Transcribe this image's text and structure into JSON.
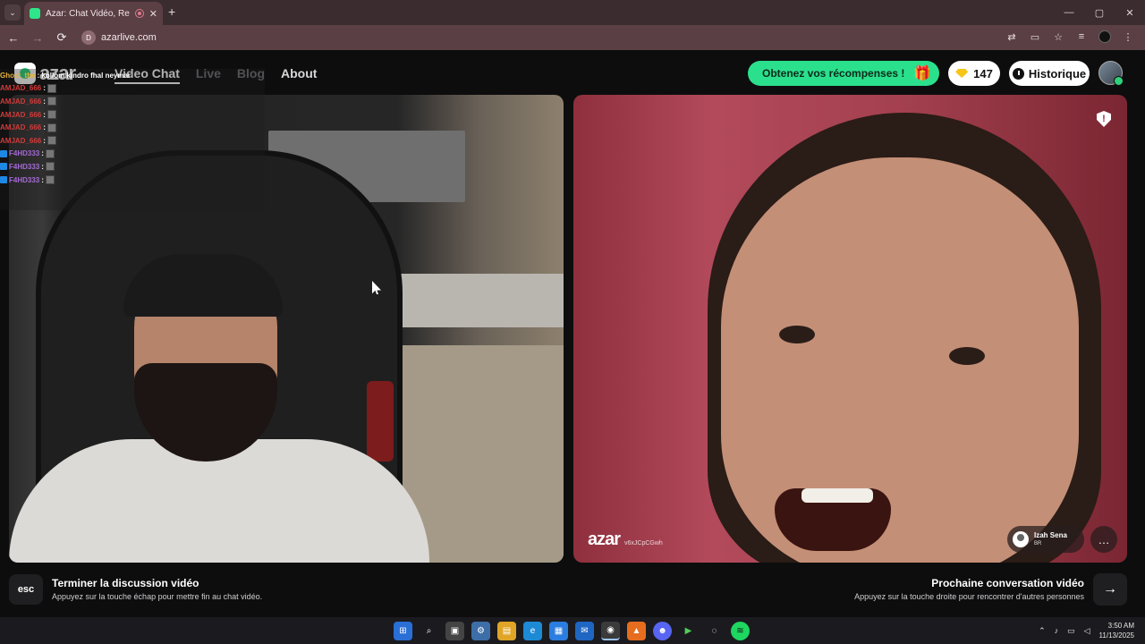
{
  "browser": {
    "tab_title": "Azar: Chat Vidéo, Rencontr",
    "new_tab": "+",
    "url": "azarlive.com",
    "window_controls": [
      "—",
      "▢",
      "✕"
    ]
  },
  "header": {
    "logo": "azar",
    "nav": [
      "Video Chat",
      "Live",
      "Blog",
      "About"
    ],
    "reward_label": "Obtenez vos récompenses !",
    "gems": "147",
    "history_label": "Historique"
  },
  "overlay_chat": {
    "first": {
      "user": "Ghost_the",
      "msg": ": kollom kindro fhal neymar"
    },
    "rows": [
      {
        "user": "AMJAD_666",
        "color": "#d23a3a"
      },
      {
        "user": "AMJAD_666",
        "color": "#d23a3a"
      },
      {
        "user": "AMJAD_666",
        "color": "#d23a3a"
      },
      {
        "user": "AMJAD_666",
        "color": "#d23a3a"
      },
      {
        "user": "AMJAD_666",
        "color": "#d23a3a"
      },
      {
        "user": "F4HD333",
        "color": "#a56ad6"
      },
      {
        "user": "F4HD333",
        "color": "#a56ad6"
      },
      {
        "user": "F4HD333",
        "color": "#a56ad6"
      }
    ]
  },
  "partner": {
    "watermark": "azar",
    "id": "v6xJCpCGwh",
    "name": "Izah Sena",
    "country": "BR"
  },
  "bottom": {
    "esc_label": "esc",
    "end_title": "Terminer la discussion vidéo",
    "end_sub": "Appuyez sur la touche échap pour mettre fin au chat vidéo.",
    "next_title": "Prochaine conversation vidéo",
    "next_sub": "Appuyez sur la touche droite pour rencontrer d'autres personnes"
  },
  "taskbar": {
    "time": "3:50 AM",
    "date": "11/13/2025"
  },
  "colors": {
    "accent": "#2be08c",
    "page_bg": "#0d0d0e",
    "chrome_bg": "#5a3f45"
  }
}
